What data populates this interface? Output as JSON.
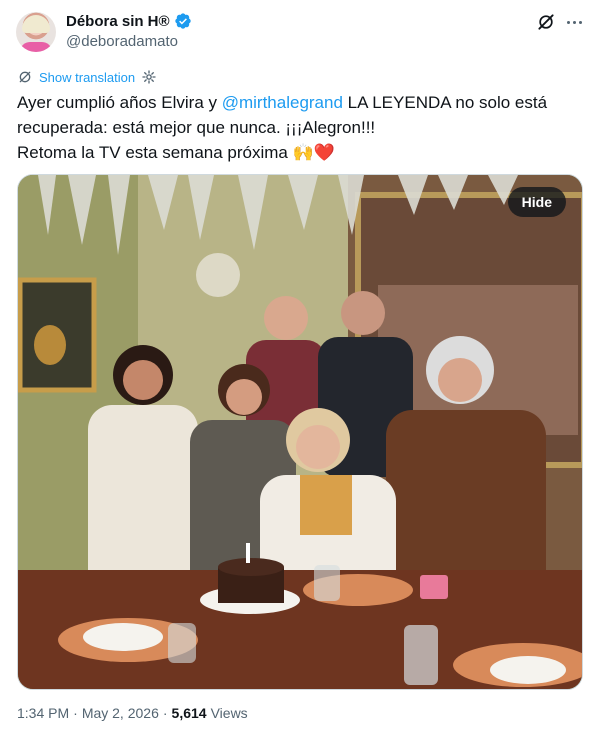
{
  "author": {
    "display_name": "Débora sin H®",
    "handle": "@deboradamato",
    "verified": true
  },
  "header": {
    "grok_icon": "grok-icon",
    "more_icon": "more-dots-icon"
  },
  "translate": {
    "label": "Show translation",
    "left_icon": "translate-icon",
    "right_icon": "settings-gear-icon"
  },
  "tweet": {
    "line1_pre": "Ayer cumplió años Elvira y ",
    "mention": "@mirthalegrand",
    "line1_post": " LA LEYENDA no solo está recuperada: está mejor que nunca. ¡¡¡Alegron!!!",
    "line2": "Retoma la TV esta semana próxima",
    "emoji": "🙌❤️"
  },
  "media": {
    "hide_label": "Hide"
  },
  "meta": {
    "time": "1:34 PM",
    "separator": "·",
    "date": "May 2, 2026",
    "views_count": "5,614",
    "views_label": "Views"
  },
  "colors": {
    "accent": "#1d9bf0",
    "text": "#0f1419",
    "secondary": "#536471"
  }
}
